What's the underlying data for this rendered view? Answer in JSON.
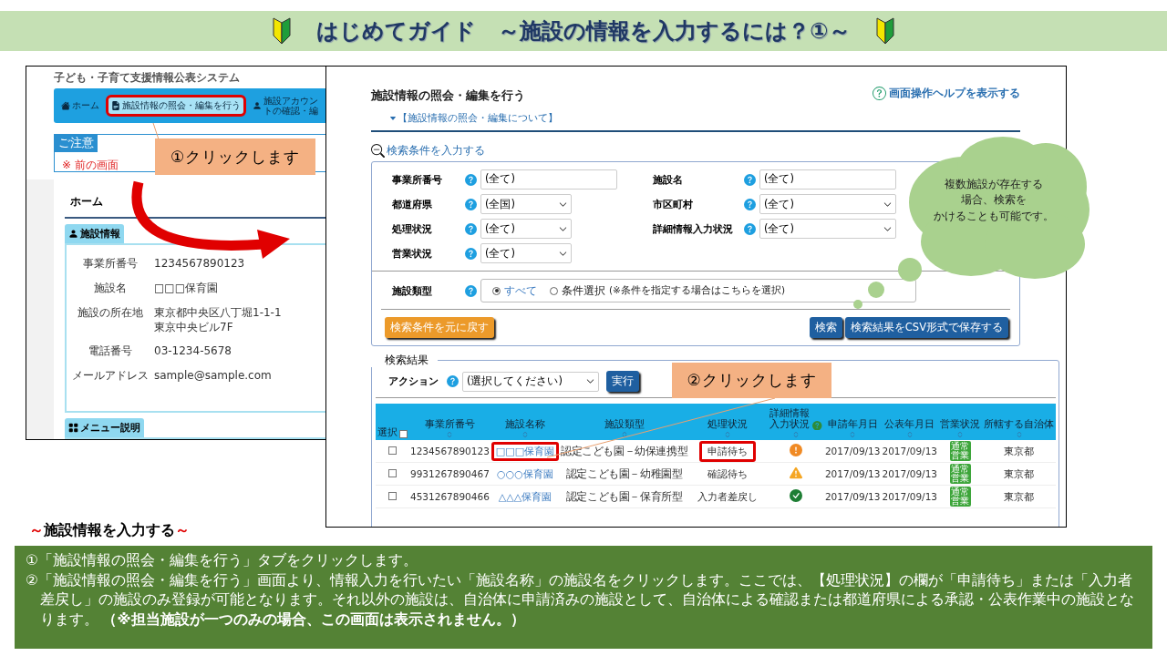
{
  "header": {
    "title": "はじめてガイド　～施設の情報を入力するには？①～"
  },
  "left_screen": {
    "system_title": "子ども・子育て支援情報公表システム",
    "nav_tabs": [
      {
        "label": "ホーム",
        "selected": false,
        "highlighted": false
      },
      {
        "label": "施設情報の照会・編集を行う",
        "selected": true,
        "highlighted": true
      },
      {
        "label": "施設アカウントの確認・編",
        "selected": false,
        "highlighted": false
      }
    ],
    "notice": {
      "label": "ご注意",
      "text": "※ 前の画面"
    },
    "page_heading": "ホーム",
    "facility_section": {
      "tab": "施設情報",
      "fields": [
        {
          "label": "事業所番号",
          "value": "1234567890123"
        },
        {
          "label": "施設名",
          "value": "□□□保育園"
        },
        {
          "label": "施設の所在地",
          "value": "東京都中央区八丁堀1-1-1\n東京中央ビル7F"
        },
        {
          "label": "電話番号",
          "value": "03-1234-5678"
        },
        {
          "label": "メールアドレス",
          "value": "sample@sample.com"
        }
      ]
    },
    "menu_section": {
      "tab": "メニュー説明"
    }
  },
  "right_screen": {
    "title": "施設情報の照会・編集を行う",
    "help_link": "画面操作ヘルプを表示する",
    "about_toggle": "【施設情報の照会・編集について】",
    "search_toggle": "検索条件を入力する",
    "search_fields": [
      {
        "label": "事業所番号",
        "value": "(全て)",
        "kind": "text"
      },
      {
        "label": "施設名",
        "value": "(全て)",
        "kind": "text"
      },
      {
        "label": "都道府県",
        "value": "(全国)",
        "kind": "select"
      },
      {
        "label": "市区町村",
        "value": "(全て)",
        "kind": "select"
      },
      {
        "label": "処理状況",
        "value": "(全て)",
        "kind": "select"
      },
      {
        "label": "詳細情報入力状況",
        "value": "(全て)",
        "kind": "select"
      },
      {
        "label": "営業状況",
        "value": "(全て)",
        "kind": "select"
      }
    ],
    "facility_type": {
      "label": "施設類型",
      "options": [
        {
          "label": "すべて",
          "selected": true
        },
        {
          "label": "条件選択",
          "note": "(※条件を指定する場合はこちらを選択)",
          "selected": false
        }
      ]
    },
    "reset_button": "検索条件を元に戻す",
    "search_button": "検索",
    "csv_button": "検索結果をCSV形式で保存する",
    "results": {
      "legend": "検索結果",
      "action_label": "アクション",
      "action_select": "(選択してください)",
      "run_button": "実行",
      "columns": [
        {
          "label": "選択",
          "checked": false
        },
        {
          "label": "事業所番号",
          "sortable": true
        },
        {
          "label": "施設名称",
          "sortable": true
        },
        {
          "label": "施設類型",
          "sortable": true
        },
        {
          "label": "処理状況",
          "sortable": true
        },
        {
          "label": "詳細情報入力状況",
          "help": true,
          "sortable": true
        },
        {
          "label": "申請年月日",
          "sortable": true
        },
        {
          "label": "公表年月日",
          "sortable": true
        },
        {
          "label": "営業状況",
          "sortable": true
        },
        {
          "label": "所轄する自治体",
          "sortable": true
        }
      ],
      "rows": [
        {
          "checked": false,
          "number": "1234567890123",
          "name": "□□□保育園",
          "name_highlighted": true,
          "type": "認定こども園－幼保連携型",
          "status": "申請待ち",
          "status_highlighted": true,
          "kind": "alert",
          "applied": "2017/09/13",
          "published": "2017/09/13",
          "business": "通常営業",
          "authority": "東京都"
        },
        {
          "checked": false,
          "number": "9931267890467",
          "name": "○○○保育園",
          "name_highlighted": false,
          "type": "認定こども園－幼稚園型",
          "status": "確認待ち",
          "status_highlighted": false,
          "kind": "warning",
          "applied": "2017/09/13",
          "published": "2017/09/13",
          "business": "通常営業",
          "authority": "東京都"
        },
        {
          "checked": false,
          "number": "4531267890466",
          "name": "△△△保育園",
          "name_highlighted": false,
          "type": "認定こども園－保育所型",
          "status": "入力者差戻し",
          "status_highlighted": false,
          "kind": "done",
          "applied": "2017/09/13",
          "published": "2017/09/13",
          "business": "通常営業",
          "authority": "東京都"
        }
      ]
    }
  },
  "callouts": [
    "①クリックします",
    "②クリックします"
  ],
  "cloud": {
    "lines": [
      "複数施設が存在する",
      "場合、検索を",
      "かけることも可能です。"
    ]
  },
  "footer": {
    "heading": "施設情報を入力する",
    "heading_mark": "～",
    "lines": [
      "①「施設情報の照会・編集を行う」タブをクリックします。",
      "②「施設情報の照会・編集を行う」画面より、情報入力を行いたい「施設名称」の施設名をクリックします。ここでは、【処理状況】の欄が「申請待ち」または「入力者差戻し」の施設のみ登録が可能となります。それ以外の施設は、自治体に申請済みの施設として、自治体による確認または都道府県による承認・公表作業中の施設となります。 **（※担当施設が一つのみの場合、この画面は表示されません。）**"
    ]
  }
}
